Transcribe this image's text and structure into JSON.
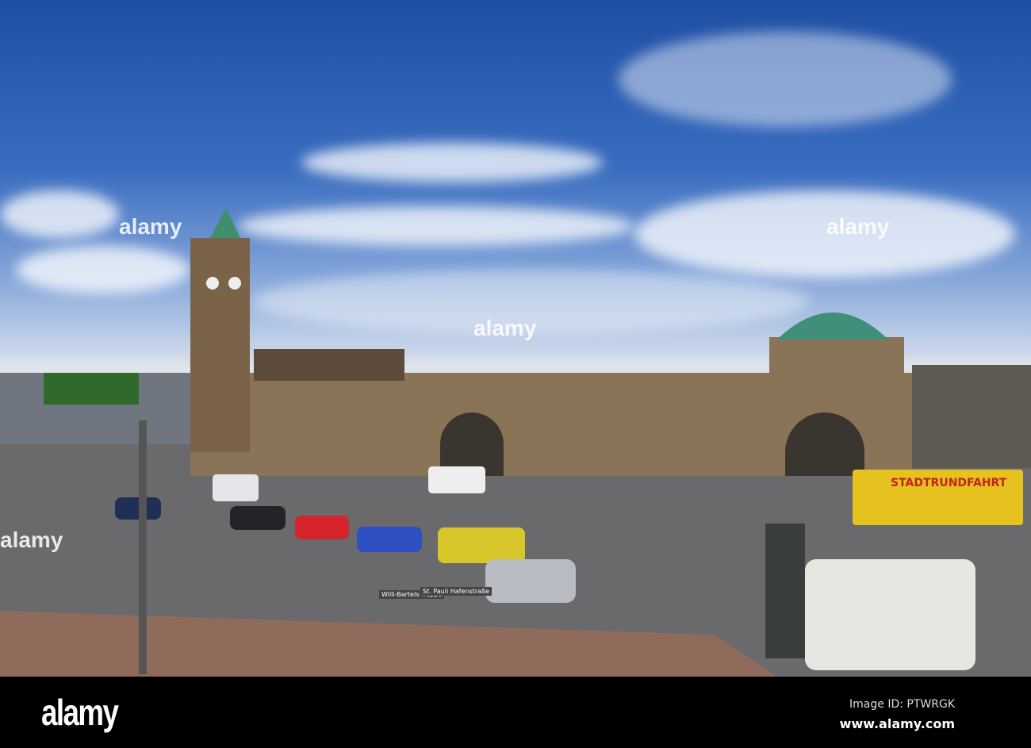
{
  "photo": {
    "subject": "Hamburg St. Pauli Landungsbrücken",
    "watermark": "alamy"
  },
  "signs": {
    "street_1": "Willi-Bartels-Treppe",
    "street_2": "St. Pauli Hafenstraße",
    "bus": "STADTRUNDFAHRT"
  },
  "footer": {
    "logo": "alamy",
    "image_id": "Image ID: PTWRGK",
    "url": "www.alamy.com"
  }
}
